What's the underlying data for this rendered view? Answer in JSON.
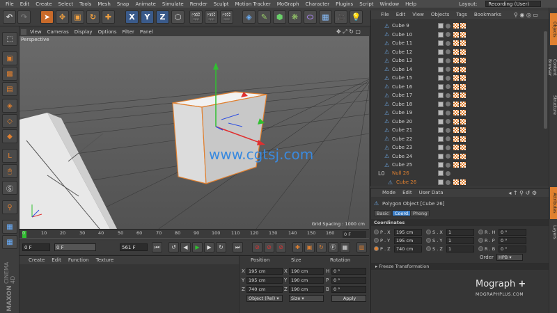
{
  "menu": [
    "File",
    "Edit",
    "Create",
    "Select",
    "Tools",
    "Mesh",
    "Snap",
    "Animate",
    "Simulate",
    "Render",
    "Sculpt",
    "Motion Tracker",
    "MoGraph",
    "Character",
    "Plugins",
    "Script",
    "Window",
    "Help"
  ],
  "layout": {
    "label": "Layout:",
    "value": "Recording (User)"
  },
  "viewport": {
    "menu": [
      "View",
      "Cameras",
      "Display",
      "Options",
      "Filter",
      "Panel"
    ],
    "label": "Perspective",
    "grid_spacing": "Grid Spacing : 1000 cm",
    "watermark": "www.cgtsj.com"
  },
  "timeline": {
    "ticks": [
      "0",
      "10",
      "20",
      "30",
      "40",
      "50",
      "60",
      "70",
      "80",
      "90",
      "100",
      "110",
      "120",
      "130",
      "140",
      "150",
      "160"
    ],
    "end_frame": "0 F"
  },
  "playbar": {
    "start": "0 F",
    "current": "0 F",
    "end": "561 F"
  },
  "materials": {
    "menu": [
      "Create",
      "Edit",
      "Function",
      "Texture"
    ]
  },
  "coordinates": {
    "headers": {
      "position": "Position",
      "size": "Size",
      "rotation": "Rotation"
    },
    "rows": [
      {
        "axis": "X",
        "pos": "195 cm",
        "size_axis": "X",
        "size": "190 cm",
        "rot_axis": "H",
        "rot": "0 °"
      },
      {
        "axis": "Y",
        "pos": "195 cm",
        "size_axis": "Y",
        "size": "190 cm",
        "rot_axis": "P",
        "rot": "0 °"
      },
      {
        "axis": "Z",
        "pos": "740 cm",
        "size_axis": "Z",
        "size": "190 cm",
        "rot_axis": "B",
        "rot": "0 °"
      }
    ],
    "mode": "Object (Rel)",
    "size_mode": "Size",
    "apply": "Apply"
  },
  "objects": {
    "menu": [
      "File",
      "Edit",
      "View",
      "Objects",
      "Tags",
      "Bookmarks"
    ],
    "items": [
      "Cube 9",
      "Cube 10",
      "Cube 11",
      "Cube 12",
      "Cube 13",
      "Cube 14",
      "Cube 15",
      "Cube 16",
      "Cube 17",
      "Cube 18",
      "Cube 19",
      "Cube 20",
      "Cube 21",
      "Cube 22",
      "Cube 23",
      "Cube 24",
      "Cube 25"
    ],
    "null_item": "Null 26",
    "selected_item": "Cube 26"
  },
  "attributes": {
    "menu": [
      "Mode",
      "Edit",
      "User Data"
    ],
    "title": "Polygon Object [Cube 26]",
    "tabs": [
      "Basic",
      "Coord.",
      "Phong"
    ],
    "section": "Coordinates",
    "rows": [
      {
        "p": "P . X",
        "pv": "195 cm",
        "s": "S . X",
        "sv": "1",
        "r": "R . H",
        "rv": "0 °"
      },
      {
        "p": "P . Y",
        "pv": "195 cm",
        "s": "S . Y",
        "sv": "1",
        "r": "R . P",
        "rv": "0 °"
      },
      {
        "p": "P . Z",
        "pv": "740 cm",
        "s": "S . Z",
        "sv": "1",
        "r": "R . B",
        "rv": "0 °"
      }
    ],
    "order_label": "Order",
    "order_value": "HPB",
    "freeze": "Freeze Transformation"
  },
  "side_tabs": [
    "Objects",
    "Content Browser",
    "Structure",
    "Attributes",
    "Layers"
  ],
  "branding": {
    "mograph": "Mograph",
    "mograph_url": "MOGRAPHPLUS.COM",
    "maxon": "MAXON",
    "cinema": "CINEMA 4D"
  },
  "colors": {
    "accent_orange": "#e08030",
    "selected_blue": "#3d7fc7",
    "axis_x": "#e03030",
    "axis_y": "#30c030",
    "axis_z": "#3050e0"
  }
}
